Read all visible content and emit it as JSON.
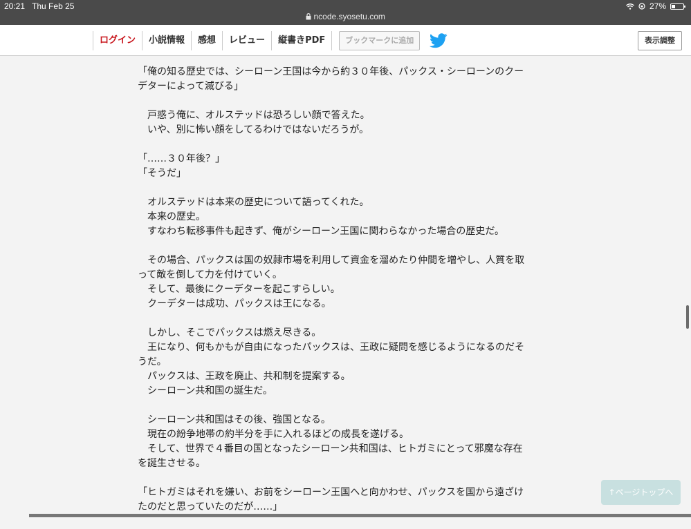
{
  "status_bar": {
    "time": "20:21",
    "date": "Thu Feb 25",
    "url": "ncode.syosetu.com",
    "battery": "27%"
  },
  "nav": {
    "items": [
      {
        "label": "ログイン"
      },
      {
        "label": "小説情報"
      },
      {
        "label": "感想"
      },
      {
        "label": "レビュー"
      },
      {
        "label": "縦書きPDF"
      }
    ],
    "bookmark_label": "ブックマークに追加",
    "display_label": "表示調整"
  },
  "content": {
    "paragraphs": [
      [
        "「俺の知る歴史では、シーローン王国は今から約３０年後、パックス・シーローンのクーデターによって滅びる」"
      ],
      [
        "　戸惑う俺に、オルステッドは恐ろしい顔で答えた。",
        "　いや、別に怖い顔をしてるわけではないだろうが。"
      ],
      [
        "「……３０年後？」",
        "「そうだ」"
      ],
      [
        "　オルステッドは本来の歴史について語ってくれた。",
        "　本来の歴史。",
        "　すなわち転移事件も起きず、俺がシーローン王国に関わらなかった場合の歴史だ。"
      ],
      [
        "　その場合、パックスは国の奴隷市場を利用して資金を溜めたり仲間を増やし、人質を取って敵を倒して力を付けていく。",
        "　そして、最後にクーデターを起こすらしい。",
        "　クーデターは成功、パックスは王になる。"
      ],
      [
        "　しかし、そこでパックスは燃え尽きる。",
        "　王になり、何もかもが自由になったパックスは、王政に疑問を感じるようになるのだそうだ。",
        "　パックスは、王政を廃止、共和制を提案する。",
        "　シーローン共和国の誕生だ。"
      ],
      [
        "　シーローン共和国はその後、強国となる。",
        "　現在の紛争地帯の約半分を手に入れるほどの成長を遂げる。",
        "　そして、世界で４番目の国となったシーローン共和国は、ヒトガミにとって邪魔な存在を誕生させる。"
      ],
      [
        "「ヒトガミはそれを嫌い、お前をシーローン王国へと向かわせ、パックスを国から遠ざけたのだと思っていたのだが……」"
      ]
    ]
  },
  "page_top_label": "↑ページトップへ"
}
